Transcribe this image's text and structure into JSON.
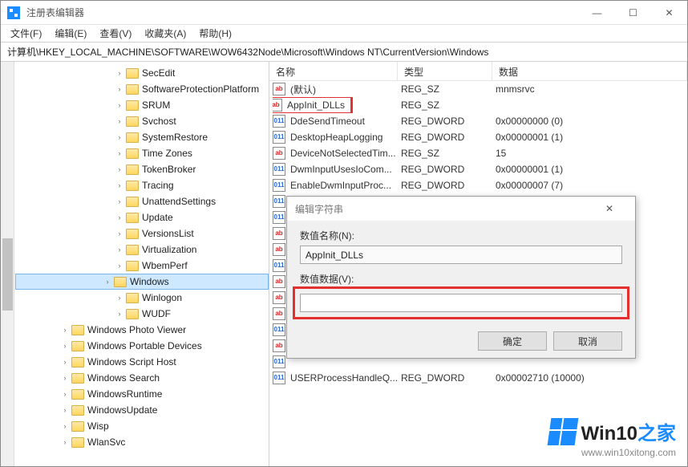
{
  "title": "注册表编辑器",
  "window_controls": {
    "min": "—",
    "max": "☐",
    "close": "✕"
  },
  "menu": [
    "文件(F)",
    "编辑(E)",
    "查看(V)",
    "收藏夹(A)",
    "帮助(H)"
  ],
  "address": "计算机\\HKEY_LOCAL_MACHINE\\SOFTWARE\\WOW6432Node\\Microsoft\\Windows NT\\CurrentVersion\\Windows",
  "tree_top": [
    "SecEdit",
    "SoftwareProtectionPlatform",
    "SRUM",
    "Svchost",
    "SystemRestore",
    "Time Zones",
    "TokenBroker",
    "Tracing",
    "UnattendSettings",
    "Update",
    "VersionsList",
    "Virtualization",
    "WbemPerf",
    "Windows",
    "Winlogon",
    "WUDF"
  ],
  "tree_bottom": [
    "Windows Photo Viewer",
    "Windows Portable Devices",
    "Windows Script Host",
    "Windows Search",
    "WindowsRuntime",
    "WindowsUpdate",
    "Wisp",
    "WlanSvc"
  ],
  "selected_tree": "Windows",
  "columns": {
    "name": "名称",
    "type": "类型",
    "data": "数据"
  },
  "values": [
    {
      "icon": "str",
      "name": "(默认)",
      "type": "REG_SZ",
      "data": "mnmsrvc"
    },
    {
      "icon": "str",
      "name": "AppInit_DLLs",
      "type": "REG_SZ",
      "data": "",
      "highlight": true
    },
    {
      "icon": "bin",
      "name": "DdeSendTimeout",
      "type": "REG_DWORD",
      "data": "0x00000000 (0)"
    },
    {
      "icon": "bin",
      "name": "DesktopHeapLogging",
      "type": "REG_DWORD",
      "data": "0x00000001 (1)"
    },
    {
      "icon": "str",
      "name": "DeviceNotSelectedTim...",
      "type": "REG_SZ",
      "data": "15"
    },
    {
      "icon": "bin",
      "name": "DwmInputUsesIoCom...",
      "type": "REG_DWORD",
      "data": "0x00000001 (1)"
    },
    {
      "icon": "bin",
      "name": "EnableDwmInputProc...",
      "type": "REG_DWORD",
      "data": "0x00000007 (7)"
    },
    {
      "icon": "bin",
      "name": "",
      "type": "",
      "data": ""
    },
    {
      "icon": "bin",
      "name": "",
      "type": "",
      "data": ""
    },
    {
      "icon": "str",
      "name": "",
      "type": "",
      "data": ""
    },
    {
      "icon": "str",
      "name": "",
      "type": "",
      "data": ""
    },
    {
      "icon": "bin",
      "name": "",
      "type": "",
      "data": ""
    },
    {
      "icon": "str",
      "name": "",
      "type": "",
      "data": ""
    },
    {
      "icon": "str",
      "name": "",
      "type": "",
      "data": ""
    },
    {
      "icon": "str",
      "name": "",
      "type": "",
      "data": ""
    },
    {
      "icon": "bin",
      "name": "",
      "type": "",
      "data": ""
    },
    {
      "icon": "str",
      "name": "",
      "type": "",
      "data": ""
    },
    {
      "icon": "bin",
      "name": "",
      "type": "",
      "data": ""
    },
    {
      "icon": "bin",
      "name": "USERProcessHandleQ...",
      "type": "REG_DWORD",
      "data": "0x00002710 (10000)"
    }
  ],
  "dialog": {
    "title": "编辑字符串",
    "name_label": "数值名称(N):",
    "name_value": "AppInit_DLLs",
    "data_label": "数值数据(V):",
    "data_value": "",
    "ok": "确定",
    "cancel": "取消"
  },
  "watermark": {
    "text_a": "Win10",
    "text_b": "之家",
    "url": "www.win10xitong.com"
  }
}
